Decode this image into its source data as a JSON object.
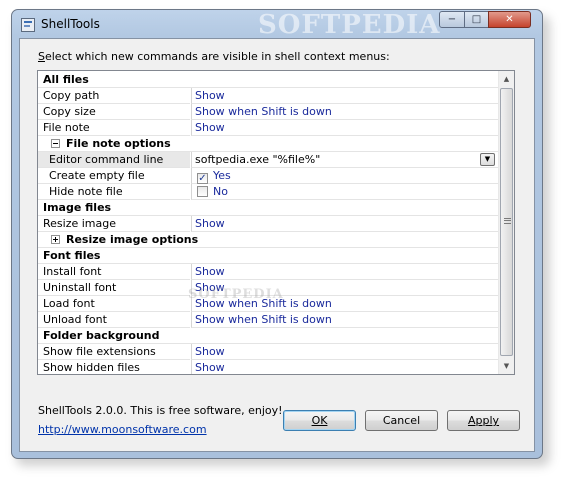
{
  "window": {
    "title": "ShellTools",
    "watermark": "SOFTPEDIA",
    "controls": {
      "minimize": "−",
      "maximize": "□",
      "close": "✕"
    }
  },
  "prompt": "Select which new commands are visible in shell context menus:",
  "prompt_underlined_char": "S",
  "prompt_rest": "elect which new commands are visible in shell context menus:",
  "grid": {
    "rows": [
      {
        "type": "category",
        "label": "All files"
      },
      {
        "type": "item",
        "label": "Copy path",
        "value": "Show"
      },
      {
        "type": "item",
        "label": "Copy size",
        "value": "Show when Shift is down"
      },
      {
        "type": "item",
        "label": "File note",
        "value": "Show"
      },
      {
        "type": "subcategory",
        "label": "File note options",
        "expanded": true
      },
      {
        "type": "item",
        "label": "Editor command line",
        "value": "softpedia.exe \"%file%\"",
        "selected": true,
        "dropdown": true
      },
      {
        "type": "check",
        "label": "Create empty file",
        "value": "Yes",
        "checked": true
      },
      {
        "type": "check",
        "label": "Hide note file",
        "value": "No",
        "checked": false
      },
      {
        "type": "category",
        "label": "Image files"
      },
      {
        "type": "item",
        "label": "Resize image",
        "value": "Show"
      },
      {
        "type": "subcategory",
        "label": "Resize image options",
        "expanded": false
      },
      {
        "type": "category",
        "label": "Font files"
      },
      {
        "type": "item",
        "label": "Install font",
        "value": "Show"
      },
      {
        "type": "item",
        "label": "Uninstall font",
        "value": "Show"
      },
      {
        "type": "item",
        "label": "Load font",
        "value": "Show when Shift is down"
      },
      {
        "type": "item",
        "label": "Unload font",
        "value": "Show when Shift is down"
      },
      {
        "type": "category",
        "label": "Folder background"
      },
      {
        "type": "item",
        "label": "Show file extensions",
        "value": "Show"
      },
      {
        "type": "item",
        "label": "Show hidden files",
        "value": "Show"
      }
    ],
    "ghost_watermark": "SOFTPEDIA"
  },
  "footer": {
    "about": "ShellTools 2.0.0. This is free software, enjoy!",
    "link": "http://www.moonsoftware.com"
  },
  "buttons": {
    "ok": "OK",
    "cancel": "Cancel",
    "apply": "Apply"
  },
  "colors": {
    "value_text": "#1a2a9c",
    "link": "#0033aa",
    "titlebar": "#bfd3ea"
  }
}
